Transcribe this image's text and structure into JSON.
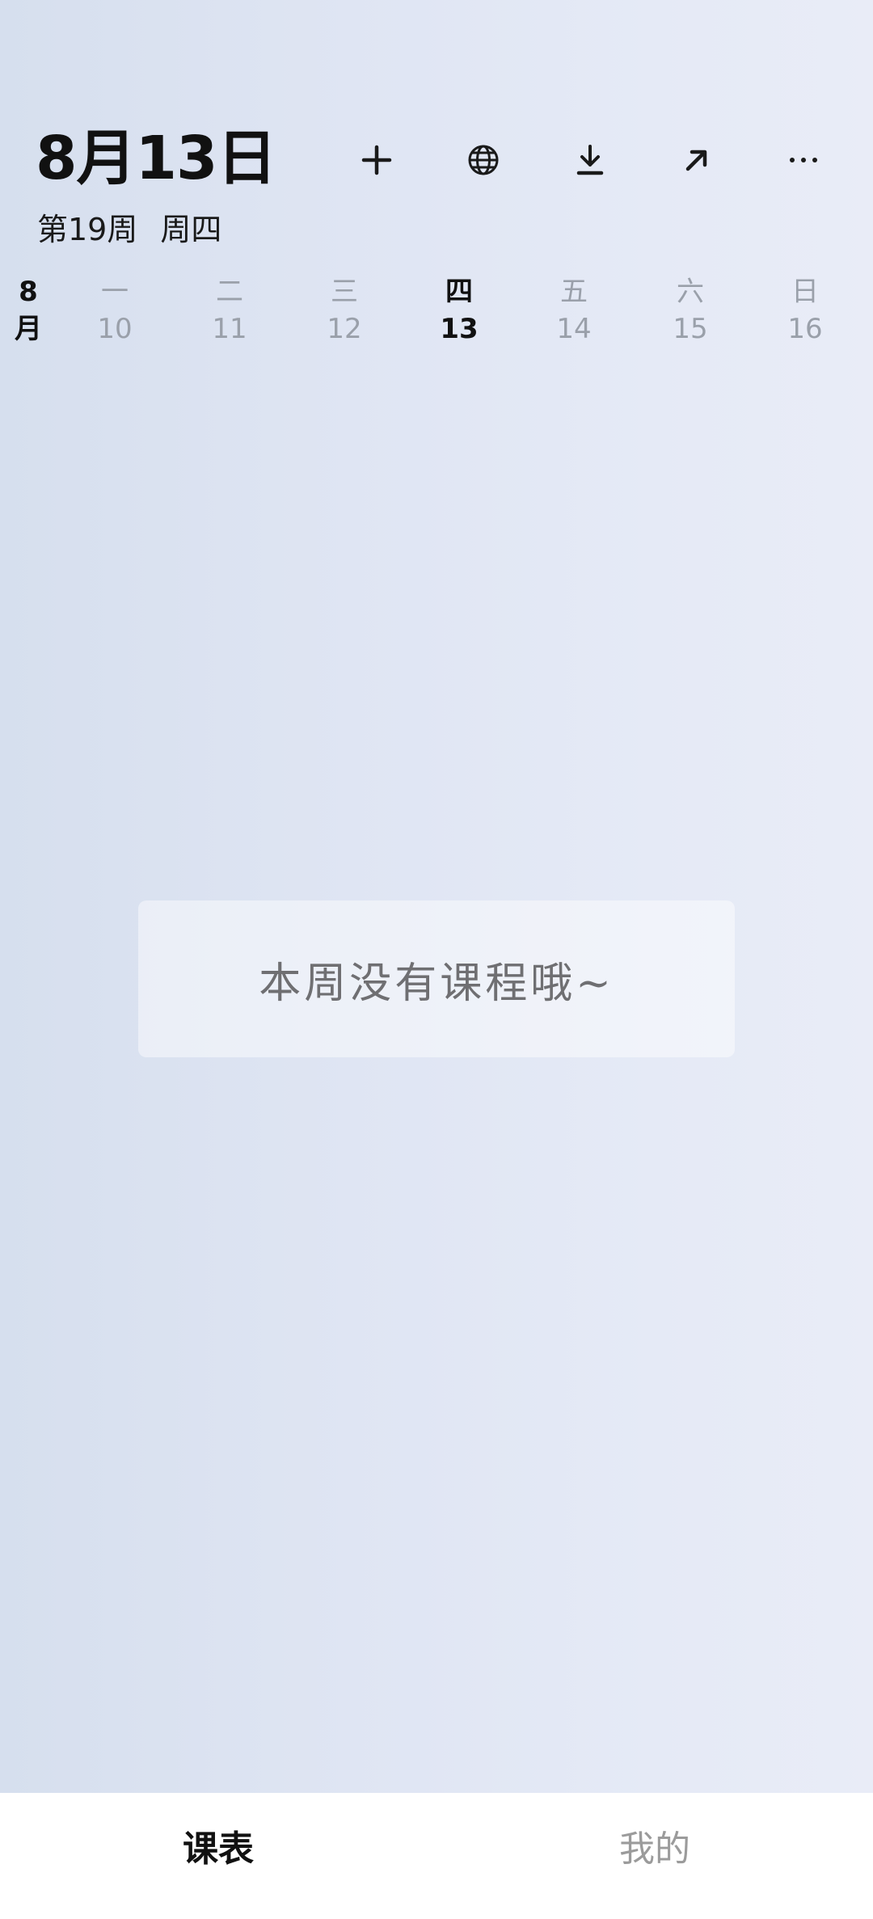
{
  "header": {
    "date_title": "8月13日",
    "week_label": "第19周",
    "weekday_label": "周四"
  },
  "toolbar": {
    "add": {
      "icon": "plus-icon"
    },
    "web": {
      "icon": "globe-icon"
    },
    "download": {
      "icon": "download-icon"
    },
    "share": {
      "icon": "arrow-up-right-icon"
    },
    "more": {
      "icon": "more-horizontal-icon"
    }
  },
  "week": {
    "month_number": "8",
    "month_char": "月",
    "days": [
      {
        "name": "一",
        "date": "10",
        "active": false
      },
      {
        "name": "二",
        "date": "11",
        "active": false
      },
      {
        "name": "三",
        "date": "12",
        "active": false
      },
      {
        "name": "四",
        "date": "13",
        "active": true
      },
      {
        "name": "五",
        "date": "14",
        "active": false
      },
      {
        "name": "六",
        "date": "15",
        "active": false
      },
      {
        "name": "日",
        "date": "16",
        "active": false
      }
    ]
  },
  "empty_state": {
    "message": "本周没有课程哦~"
  },
  "bottom_nav": {
    "schedule_label": "课表",
    "mine_label": "我的"
  },
  "colors": {
    "active_text": "#111111",
    "inactive_text": "#9aa0aa",
    "nav_bg": "#ffffff"
  }
}
